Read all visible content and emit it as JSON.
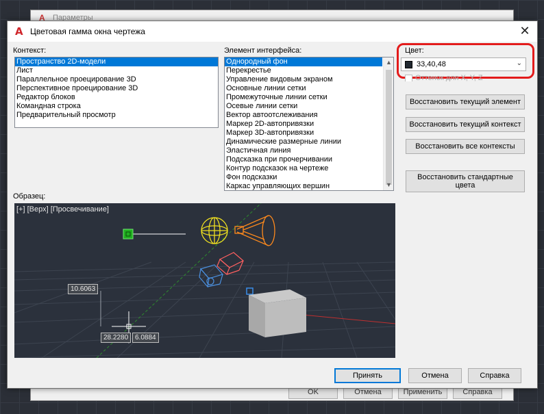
{
  "parent_window": {
    "title": "Параметры",
    "buttons": [
      "OK",
      "Отмена",
      "Применить",
      "Справка"
    ]
  },
  "dialog": {
    "title": "Цветовая гамма окна чертежа",
    "close_label": "✕"
  },
  "context": {
    "label": "Контекст:",
    "items": [
      "Пространство 2D-модели",
      "Лист",
      "Параллельное проецирование 3D",
      "Перспективное проецирование 3D",
      "Редактор блоков",
      "Командная строка",
      "Предварительный просмотр"
    ],
    "selected_index": 0
  },
  "interface_element": {
    "label": "Элемент интерфейса:",
    "items": [
      "Однородный фон",
      "Перекрестье",
      "Управление видовым экраном",
      "Основные линии сетки",
      "Промежуточные линии сетки",
      "Осевые линии сетки",
      "Вектор автоотслеживания",
      "Маркер 2D-автопривязки",
      "Маркер 3D-автопривязки",
      "Динамические размерные линии",
      "Эластичная линия",
      "Подсказка при прочерчивании",
      "Контур подсказок на чертеже",
      "Фон подсказки",
      "Каркас управляющих вершин"
    ],
    "selected_index": 0
  },
  "color": {
    "label": "Цвет:",
    "value": "33,40,48",
    "swatch": "#212830",
    "tint_label": "Оттенок для X, Y, Z"
  },
  "buttons": {
    "restore_element": "Восстановить текущий элемент",
    "restore_context": "Восстановить текущий контекст",
    "restore_all": "Восстановить все контексты",
    "restore_default": "Восстановить стандартные цвета",
    "apply": "Принять",
    "cancel": "Отмена",
    "help": "Справка"
  },
  "preview": {
    "label": "Образец:",
    "viewport_caption": "[+] [Верх] [Просвечивание]",
    "dim_left": "10.6063",
    "dim_x": "28.2280",
    "dim_y": "6.0884",
    "background": "#2b313c"
  },
  "colors": {
    "selection": "#0078d7",
    "highlight": "#e31b1b"
  }
}
